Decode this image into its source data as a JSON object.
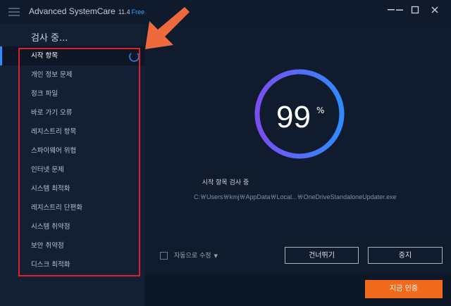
{
  "app": {
    "title": "Advanced SystemCare",
    "version": "11.4",
    "edition": "Free"
  },
  "window_controls": {
    "menu": "☰",
    "minimize": "—",
    "maximize": "☐",
    "close": "✕"
  },
  "sidebar": {
    "heading": "검사 중...",
    "items": [
      {
        "label": "시작 항목"
      },
      {
        "label": "개인 정보 문제"
      },
      {
        "label": "정크 파일"
      },
      {
        "label": "바로 가기 오류"
      },
      {
        "label": "레지스트리 항목"
      },
      {
        "label": "스파이웨어 위협"
      },
      {
        "label": "인터넷 문제"
      },
      {
        "label": "시스템 최적화"
      },
      {
        "label": "레지스트리 단편화"
      },
      {
        "label": "시스템 취약점"
      },
      {
        "label": "보안 취약점"
      },
      {
        "label": "디스크 최적화"
      }
    ],
    "active_index": 0
  },
  "scan": {
    "percent": "99",
    "percent_sign": "%",
    "progress_fraction": 0.99,
    "status": "시작 항목 검사 중",
    "path": "C:￦Users￦kmj￦AppData￦Local...￦OneDriveStandaloneUpdater.exe"
  },
  "controls": {
    "auto_fix_label": "자동으로 수정",
    "auto_fix_checked": false,
    "skip_label": "건너뛰기",
    "stop_label": "중지",
    "fix_now_label": "지금 인증"
  },
  "colors": {
    "accent": "#2f8bff",
    "ring_start": "#7a4df0",
    "ring_end": "#2f8bff",
    "highlight": "#e01f2c",
    "arrow": "#ee6a3c",
    "fix_button": "#f26b1d"
  }
}
